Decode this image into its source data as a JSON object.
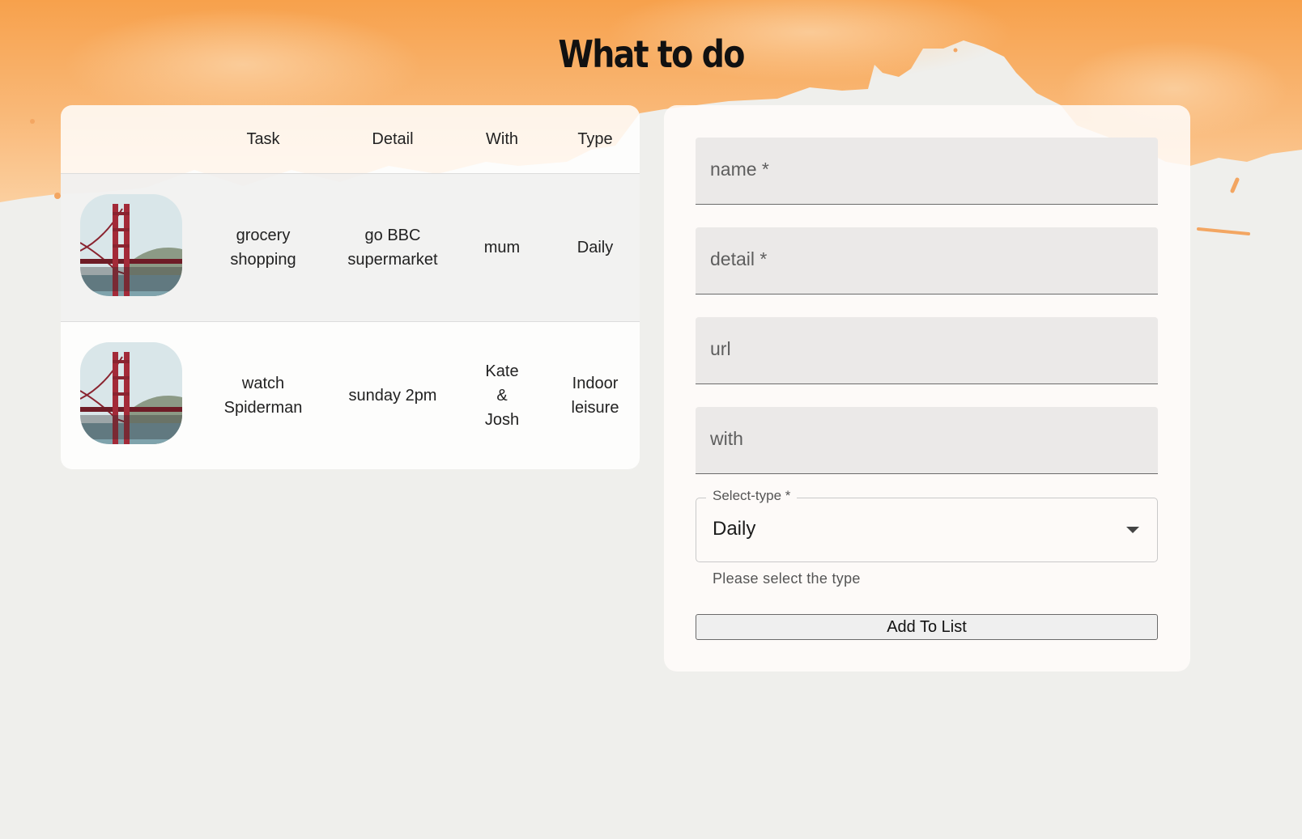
{
  "title": "What to do",
  "table": {
    "headers": {
      "image": "",
      "task": "Task",
      "detail": "Detail",
      "with": "With",
      "type": "Type"
    },
    "rows": [
      {
        "image": "golden-gate-bridge-photo",
        "task": "grocery shopping",
        "detail": "go BBC supermarket",
        "with": "mum",
        "type": "Daily"
      },
      {
        "image": "golden-gate-bridge-photo",
        "task": "watch Spiderman",
        "detail": "sunday 2pm",
        "with": "Kate & Josh",
        "type": "Indoor leisure"
      }
    ]
  },
  "form": {
    "name_placeholder": "name *",
    "detail_placeholder": "detail *",
    "url_placeholder": "url",
    "with_placeholder": "with",
    "select_label": "Select-type *",
    "select_value": "Daily",
    "select_helper": "Please select the type",
    "submit_label": "Add To List"
  },
  "colors": {
    "accent_orange": "#f6a85a",
    "paper": "#efefec"
  }
}
